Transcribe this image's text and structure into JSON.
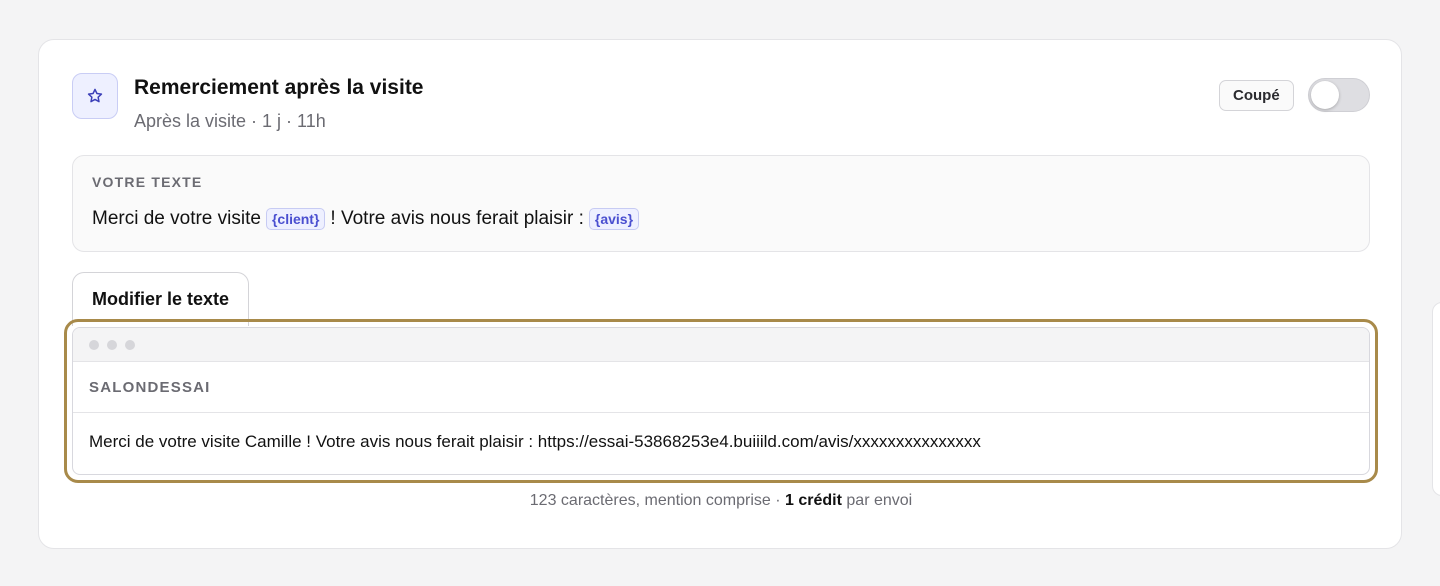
{
  "header": {
    "title": "Remerciement après la visite",
    "subtitle": "Après la visite · 1 j · 11h",
    "status_label": "Coupé",
    "toggle_on": false,
    "icon": "star-icon"
  },
  "template": {
    "label": "VOTRE TEXTE",
    "part1": "Merci de votre visite",
    "var_client": "{client}",
    "part2": "! Votre avis nous ferait plaisir :",
    "var_avis": "{avis}"
  },
  "edit_button_label": "Modifier le texte",
  "preview": {
    "sender": "SALONDESSAI",
    "message": "Merci de votre visite Camille ! Votre avis nous ferait plaisir : https://essai-53868253e4.buiiild.com/avis/xxxxxxxxxxxxxxx"
  },
  "footer": {
    "count_text": "123 caractères, mention comprise ·",
    "credit_text": "1 crédit",
    "suffix_text": "par envoi"
  },
  "colors": {
    "accent": "#4a4fd0",
    "highlight_outline": "#a88a4a"
  }
}
